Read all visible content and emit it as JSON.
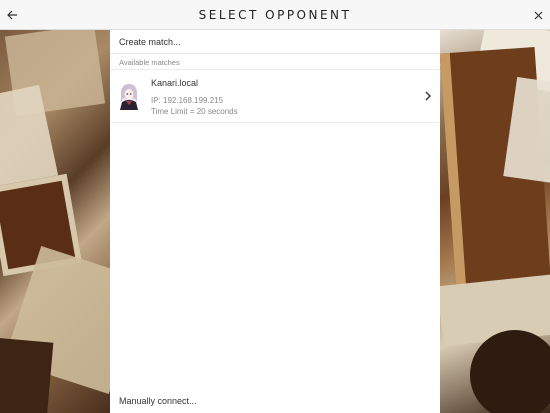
{
  "header": {
    "title": "Select Opponent",
    "back_icon": "arrow-left-icon",
    "close_icon": "close-icon"
  },
  "panel": {
    "create_match_label": "Create match...",
    "available_label": "Available matches",
    "matches": [
      {
        "name": "Kanari.local",
        "ip": "IP: 192.168.199.215",
        "time_limit": "Time Limit = 20 seconds",
        "avatar_icon": "anime-character-avatar"
      }
    ],
    "manual_connect_label": "Manually connect..."
  },
  "colors": {
    "titlebar_bg": "#f7f7f7",
    "text_primary": "#333333",
    "text_secondary": "#8a8a8a"
  }
}
